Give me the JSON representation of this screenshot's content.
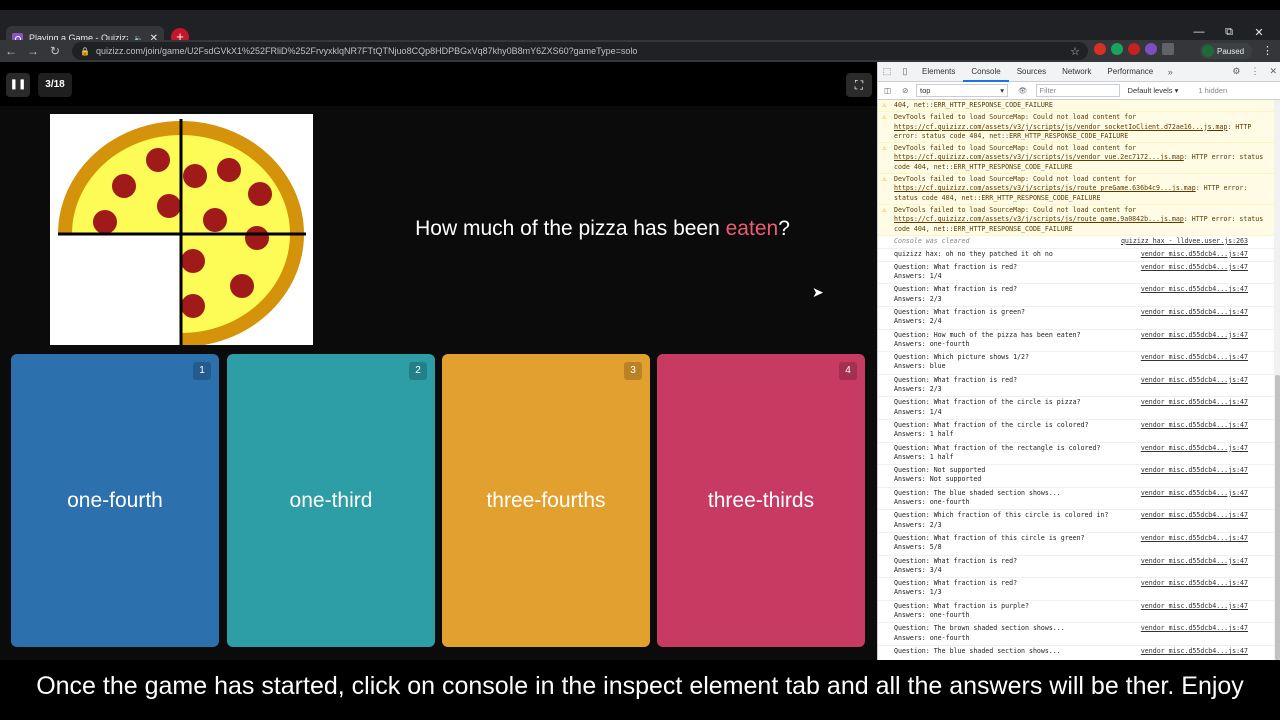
{
  "browser": {
    "tab_title": "Playing a Game - Quizizz",
    "url": "quizizz.com/join/game/U2FsdGVkX1%252FRliD%252FrvyxklqNR7FTtQTNjuo8CQp8HDPBGxVq87khy0B8mY6ZXS60?gameType=solo",
    "profile_label": "Paused"
  },
  "game": {
    "question_counter": "3/18",
    "question_prefix": "How much of the pizza has been ",
    "question_highlight": "eaten",
    "question_suffix": "?",
    "options": [
      {
        "number": "1",
        "label": "one-fourth",
        "color": "#2d70ae"
      },
      {
        "number": "2",
        "label": "one-third",
        "color": "#2d9da6"
      },
      {
        "number": "3",
        "label": "three-fourths",
        "color": "#e2a02e"
      },
      {
        "number": "4",
        "label": "three-thirds",
        "color": "#c73b63"
      }
    ]
  },
  "devtools": {
    "tabs": [
      "Elements",
      "Console",
      "Sources",
      "Network",
      "Performance"
    ],
    "active_tab": "Console",
    "context": "top",
    "filter_placeholder": "Filter",
    "levels": "Default levels",
    "hidden": "1 hidden",
    "warnings": [
      {
        "pre": "",
        "text": "404, net::ERR_HTTP_RESPONSE_CODE_FAILURE"
      },
      {
        "pre": "DevTools failed to load SourceMap: Could not load content for ",
        "link": "https://cf.quizizz.com/assets/v3/j/scripts/js/vendor_socketIoClient.d72ae16...js.map",
        "text": ": HTTP error: status code 404, net::ERR_HTTP_RESPONSE_CODE_FAILURE"
      },
      {
        "pre": "DevTools failed to load SourceMap: Could not load content for ",
        "link": "https://cf.quizizz.com/assets/v3/j/scripts/js/vendor_vue.2ec7172...js.map",
        "text": ": HTTP error: status code 404, net::ERR_HTTP_RESPONSE_CODE_FAILURE"
      },
      {
        "pre": "DevTools failed to load SourceMap: Could not load content for ",
        "link": "https://cf.quizizz.com/assets/v3/j/scripts/js/route_preGame.636b4c9...js.map",
        "text": ": HTTP error: status code 404, net::ERR_HTTP_RESPONSE_CODE_FAILURE"
      },
      {
        "pre": "DevTools failed to load SourceMap: Could not load content for ",
        "link": "https://cf.quizizz.com/assets/v3/j/scripts/js/route_game.9a0842b...js.map",
        "text": ": HTTP error: status code 404, net::ERR_HTTP_RESPONSE_CODE_FAILURE"
      }
    ],
    "cleared_text": "Console was cleared",
    "cleared_src": "quizizz hax - lldvee.user.js:263",
    "hax_line": "quizizz hax:  oh no they patched it oh no",
    "log_src": "vendor misc.d55dcb4...js:47",
    "entries": [
      {
        "q": "Question: What fraction is red?",
        "a": "  Answers: 1/4"
      },
      {
        "q": "Question: What fraction is red?",
        "a": "  Answers: 2/3"
      },
      {
        "q": "Question: What fraction is green?",
        "a": "  Answers: 2/4"
      },
      {
        "q": "Question: How much of the pizza has been eaten?",
        "a": "  Answers: one-fourth"
      },
      {
        "q": "Question: Which picture shows 1/2?",
        "a": "  Answers: blue"
      },
      {
        "q": "Question: What fraction is red?",
        "a": "  Answers: 2/3"
      },
      {
        "q": "Question: What fraction of the circle is pizza?",
        "a": "  Answers: 1/4"
      },
      {
        "q": "Question: What fraction of the circle is colored?",
        "a": "  Answers: 1 half"
      },
      {
        "q": "Question: What fraction of the rectangle is colored?",
        "a": "  Answers: 1 half"
      },
      {
        "q": "Question: Not supported",
        "a": "  Answers: Not supported"
      },
      {
        "q": "Question: The blue shaded section shows...",
        "a": "  Answers: one-fourth"
      },
      {
        "q": "Question: Which fraction of this circle is colored in?",
        "a": "  Answers: 2/3"
      },
      {
        "q": "Question: What fraction of this circle is green?",
        "a": "  Answers: 5/8"
      },
      {
        "q": "Question: What fraction is red?",
        "a": "  Answers: 3/4"
      },
      {
        "q": "Question: What fraction is red?",
        "a": "  Answers: 1/3"
      },
      {
        "q": "Question: What fraction is purple?",
        "a": "  Answers: one-fourth"
      },
      {
        "q": "Question: The brown shaded section shows...",
        "a": "  Answers: one-fourth"
      },
      {
        "q": "Question: The blue shaded section shows...",
        "a": ""
      }
    ]
  },
  "caption": "Once the game has started, click on console in the inspect element tab and all the answers will be ther. Enjoy"
}
